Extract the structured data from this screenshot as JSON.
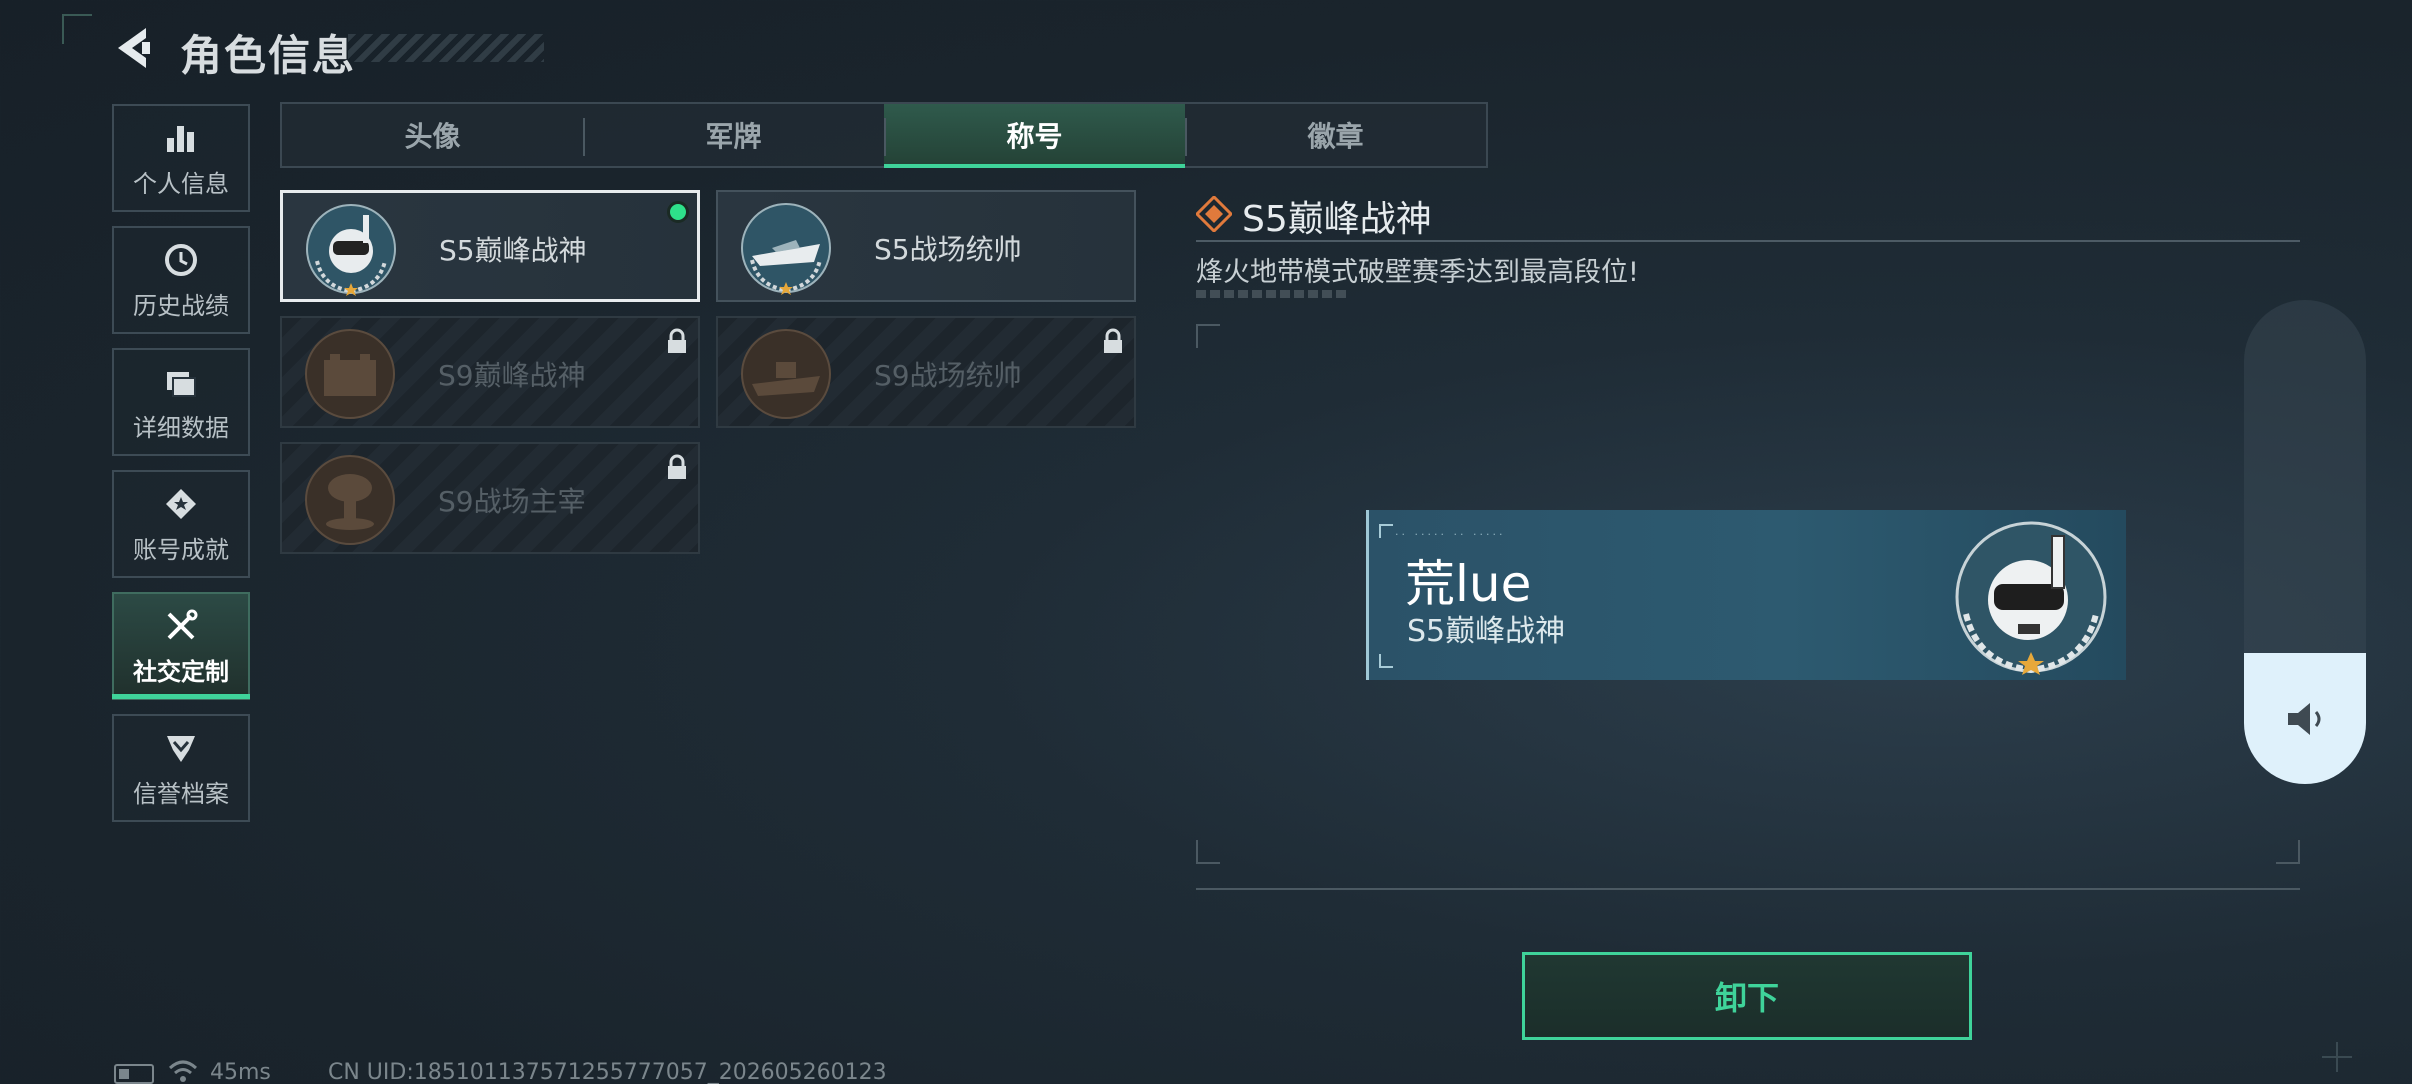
{
  "header": {
    "title": "角色信息"
  },
  "sidebar": {
    "items": [
      {
        "label": "个人信息",
        "icon": "bar-chart-icon"
      },
      {
        "label": "历史战绩",
        "icon": "clock-icon"
      },
      {
        "label": "详细数据",
        "icon": "folders-icon"
      },
      {
        "label": "账号成就",
        "icon": "achievement-icon"
      },
      {
        "label": "社交定制",
        "icon": "tools-icon",
        "active": true
      },
      {
        "label": "信誉档案",
        "icon": "credit-icon"
      }
    ]
  },
  "tabs": [
    {
      "label": "头像"
    },
    {
      "label": "军牌"
    },
    {
      "label": "称号",
      "active": true
    },
    {
      "label": "徽章"
    }
  ],
  "titles": [
    {
      "name": "S5巅峰战神",
      "medal": "skull-diver-medal",
      "state": "equipped"
    },
    {
      "name": "S5战场统帅",
      "medal": "speedboat-medal",
      "state": "unlocked"
    },
    {
      "name": "S9巅峰战神",
      "medal": "fortress-medal",
      "state": "locked"
    },
    {
      "name": "S9战场统帅",
      "medal": "warship-medal",
      "state": "locked"
    },
    {
      "name": "S9战场主宰",
      "medal": "mushroom-cloud-medal",
      "state": "locked"
    }
  ],
  "detail": {
    "title": "S5巅峰战神",
    "description": "烽火地带模式破壁赛季达到最高段位!"
  },
  "nameplate": {
    "player_name": "荒lue",
    "title": "S5巅峰战神"
  },
  "actions": {
    "unequip_label": "卸下"
  },
  "volume": {
    "level": 0.27
  },
  "status_bar": {
    "ping": "45ms",
    "uid": "CN UID:185101137571255777057_202605260123"
  },
  "colors": {
    "accent": "#3fd39a",
    "background": "#1f2c36",
    "nameplate": "#2d5a70"
  }
}
